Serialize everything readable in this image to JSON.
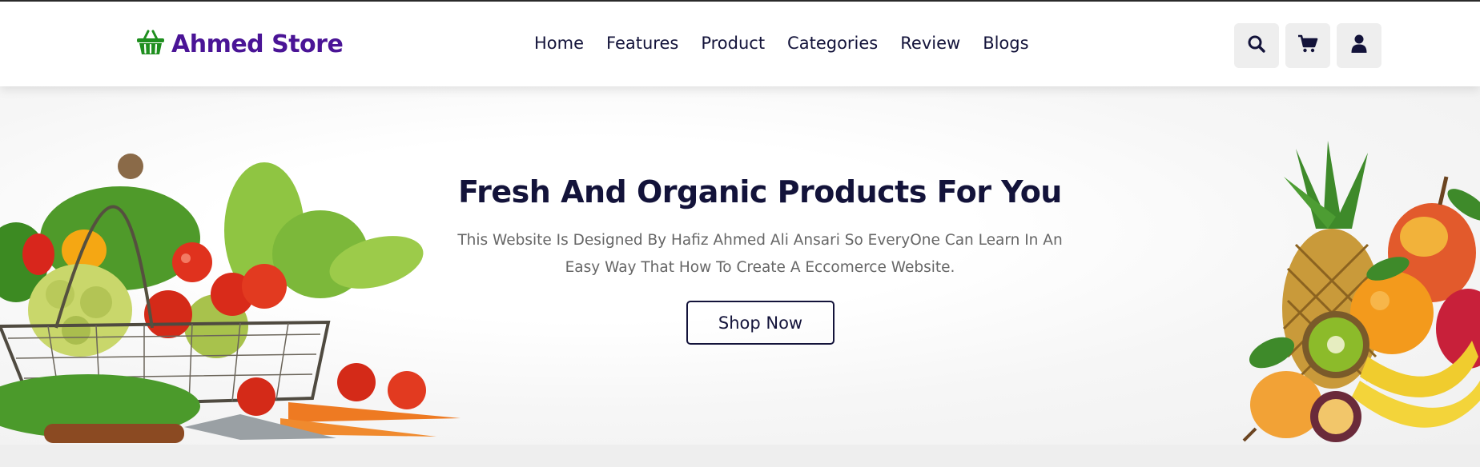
{
  "brand": {
    "name": "Ahmed Store",
    "icon": "shopping-basket-icon",
    "color": "#4a1496",
    "icon_color": "#1f8f1f"
  },
  "nav": {
    "items": [
      {
        "label": "Home"
      },
      {
        "label": "Features"
      },
      {
        "label": "Product"
      },
      {
        "label": "Categories"
      },
      {
        "label": "Review"
      },
      {
        "label": "Blogs"
      }
    ]
  },
  "header_icons": [
    {
      "icon": "search-icon"
    },
    {
      "icon": "shopping-cart-icon"
    },
    {
      "icon": "user-icon"
    }
  ],
  "hero": {
    "title": "Fresh And Organic Products For You",
    "description": "This Website Is Designed By Hafiz Ahmed Ali Ansari So EveryOne Can Learn In An Easy Way That How To Create A Eccomerce Website.",
    "cta_label": "Shop Now",
    "left_image": "vegetable-basket-image",
    "right_image": "fruit-pile-image"
  },
  "colors": {
    "heading": "#13133a",
    "body_text": "#666666",
    "icon_bg": "#eeeeee"
  }
}
